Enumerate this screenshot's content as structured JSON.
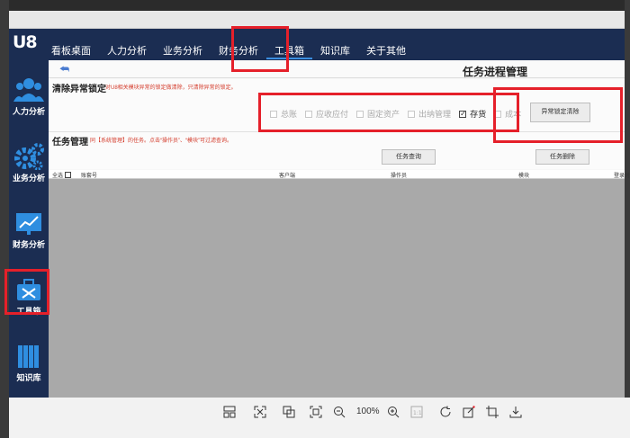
{
  "logo": "U8",
  "nav": [
    "看板桌面",
    "人力分析",
    "业务分析",
    "财务分析",
    "工具箱",
    "知识库",
    "关于其他"
  ],
  "nav_active": "工具箱",
  "sidebar": [
    "人力分析",
    "业务分析",
    "财务分析",
    "工具箱",
    "知识库"
  ],
  "page": {
    "back": "⮪",
    "title": "任务进程管理"
  },
  "section1": {
    "title": "清除异常锁定",
    "note": "对U8相关模块异常的锁定做清除，只清除异常的锁定。",
    "modules": [
      {
        "label": "总账",
        "checked": false
      },
      {
        "label": "应收应付",
        "checked": false
      },
      {
        "label": "固定资产",
        "checked": false
      },
      {
        "label": "出纳管理",
        "checked": false
      },
      {
        "label": "存货",
        "checked": true
      },
      {
        "label": "成本",
        "checked": false
      }
    ],
    "clear_button": "异常锁定清除"
  },
  "section2": {
    "title": "任务管理",
    "note": "同【系统管理】的任务。点击“操作员”、“模块”可过滤查询。",
    "query_button": "任务查询",
    "delete_button": "任务删除"
  },
  "table": {
    "select_all": "全选",
    "columns": [
      "账套号",
      "客户端",
      "操作员",
      "模块",
      "登录时"
    ]
  },
  "toolbar": {
    "zoom": "100%"
  },
  "colors": {
    "navy": "#1b2d52",
    "highlight": "#e5202a",
    "grid": "#a9a9a9"
  }
}
